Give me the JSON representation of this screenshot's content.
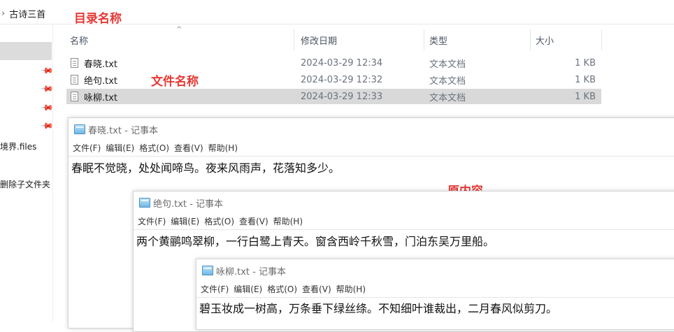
{
  "explorer": {
    "breadcrumb": {
      "chevron": "›",
      "folder": "古诗三首"
    },
    "columns": {
      "name": "名称",
      "modified": "修改日期",
      "type": "类型",
      "size": "大小"
    },
    "sidebar": {
      "item1": "境界.files",
      "item2": "删除子文件夹"
    },
    "files": [
      {
        "name": "春晓.txt",
        "modified": "2024-03-29 12:34",
        "type": "文本文档",
        "size": "1 KB"
      },
      {
        "name": "绝句.txt",
        "modified": "2024-03-29 12:32",
        "type": "文本文档",
        "size": "1 KB"
      },
      {
        "name": "咏柳.txt",
        "modified": "2024-03-29 12:33",
        "type": "文本文档",
        "size": "1 KB",
        "selected": true
      }
    ]
  },
  "annotations": {
    "dir_name": "目录名称",
    "file_name": "文件名称",
    "original_content": "原内容",
    "color": "#e53935"
  },
  "notepads": [
    {
      "title": "春晓.txt - 记事本",
      "menu": [
        "文件(F)",
        "编辑(E)",
        "格式(O)",
        "查看(V)",
        "帮助(H)"
      ],
      "content": "春眠不觉晓，处处闻啼鸟。夜来风雨声，花落知多少。"
    },
    {
      "title": "绝句.txt - 记事本",
      "menu": [
        "文件(F)",
        "编辑(E)",
        "格式(O)",
        "查看(V)",
        "帮助(H)"
      ],
      "content": "两个黄鹂鸣翠柳，一行白鹭上青天。窗含西岭千秋雪，门泊东吴万里船。"
    },
    {
      "title": "咏柳.txt - 记事本",
      "menu": [
        "文件(F)",
        "编辑(E)",
        "格式(O)",
        "查看(V)",
        "帮助(H)"
      ],
      "content": "碧玉妆成一树高，万条垂下绿丝绦。不知细叶谁裁出，二月春风似剪刀。"
    }
  ]
}
